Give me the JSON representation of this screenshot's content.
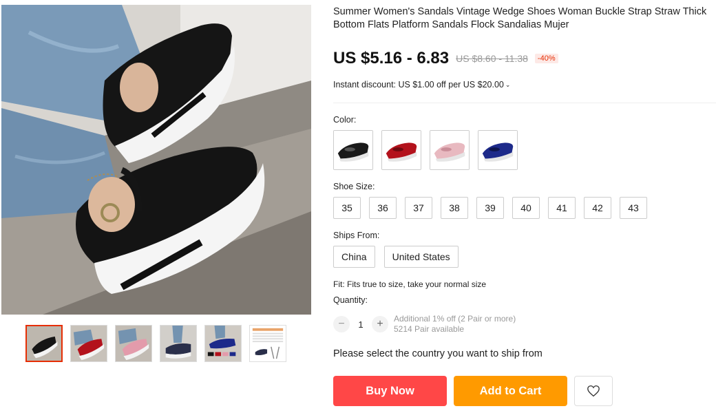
{
  "product": {
    "title": "Summer Women's Sandals Vintage Wedge Shoes Woman Buckle Strap Straw Thick Bottom Flats Platform Sandals Flock Sandalias Mujer",
    "price": "US $5.16 - 6.83",
    "original_price": "US $8.60 - 11.38",
    "discount": "-40%",
    "instant_discount": "Instant discount: US $1.00 off per US $20.00"
  },
  "gallery": {
    "thumbnails": [
      "black-shoe",
      "red-shoe",
      "pink-shoe",
      "denim-shoe",
      "blue-shoe",
      "size-chart"
    ],
    "active_index": 0
  },
  "color": {
    "label": "Color:",
    "options": [
      {
        "name": "black",
        "hex": "#1a1a1a"
      },
      {
        "name": "red",
        "hex": "#b3121c"
      },
      {
        "name": "pink",
        "hex": "#e8b9c0"
      },
      {
        "name": "blue",
        "hex": "#1d2a8a"
      }
    ]
  },
  "size": {
    "label": "Shoe Size:",
    "options": [
      "35",
      "36",
      "37",
      "38",
      "39",
      "40",
      "41",
      "42",
      "43"
    ]
  },
  "ships_from": {
    "label": "Ships From:",
    "options": [
      "China",
      "United States"
    ]
  },
  "fit": "Fit: Fits true to size, take your normal size",
  "quantity": {
    "label": "Quantity:",
    "value": "1",
    "minus": "−",
    "plus": "+",
    "additional": "Additional 1% off (2 Pair or more)",
    "available": "5214 Pair available"
  },
  "ship_message": "Please select the country you want to ship from",
  "actions": {
    "buy_now": "Buy Now",
    "add_to_cart": "Add to Cart"
  },
  "colors": {
    "accent": "#ff4747",
    "cart": "#ff9a00",
    "discount": "#e62e04"
  }
}
